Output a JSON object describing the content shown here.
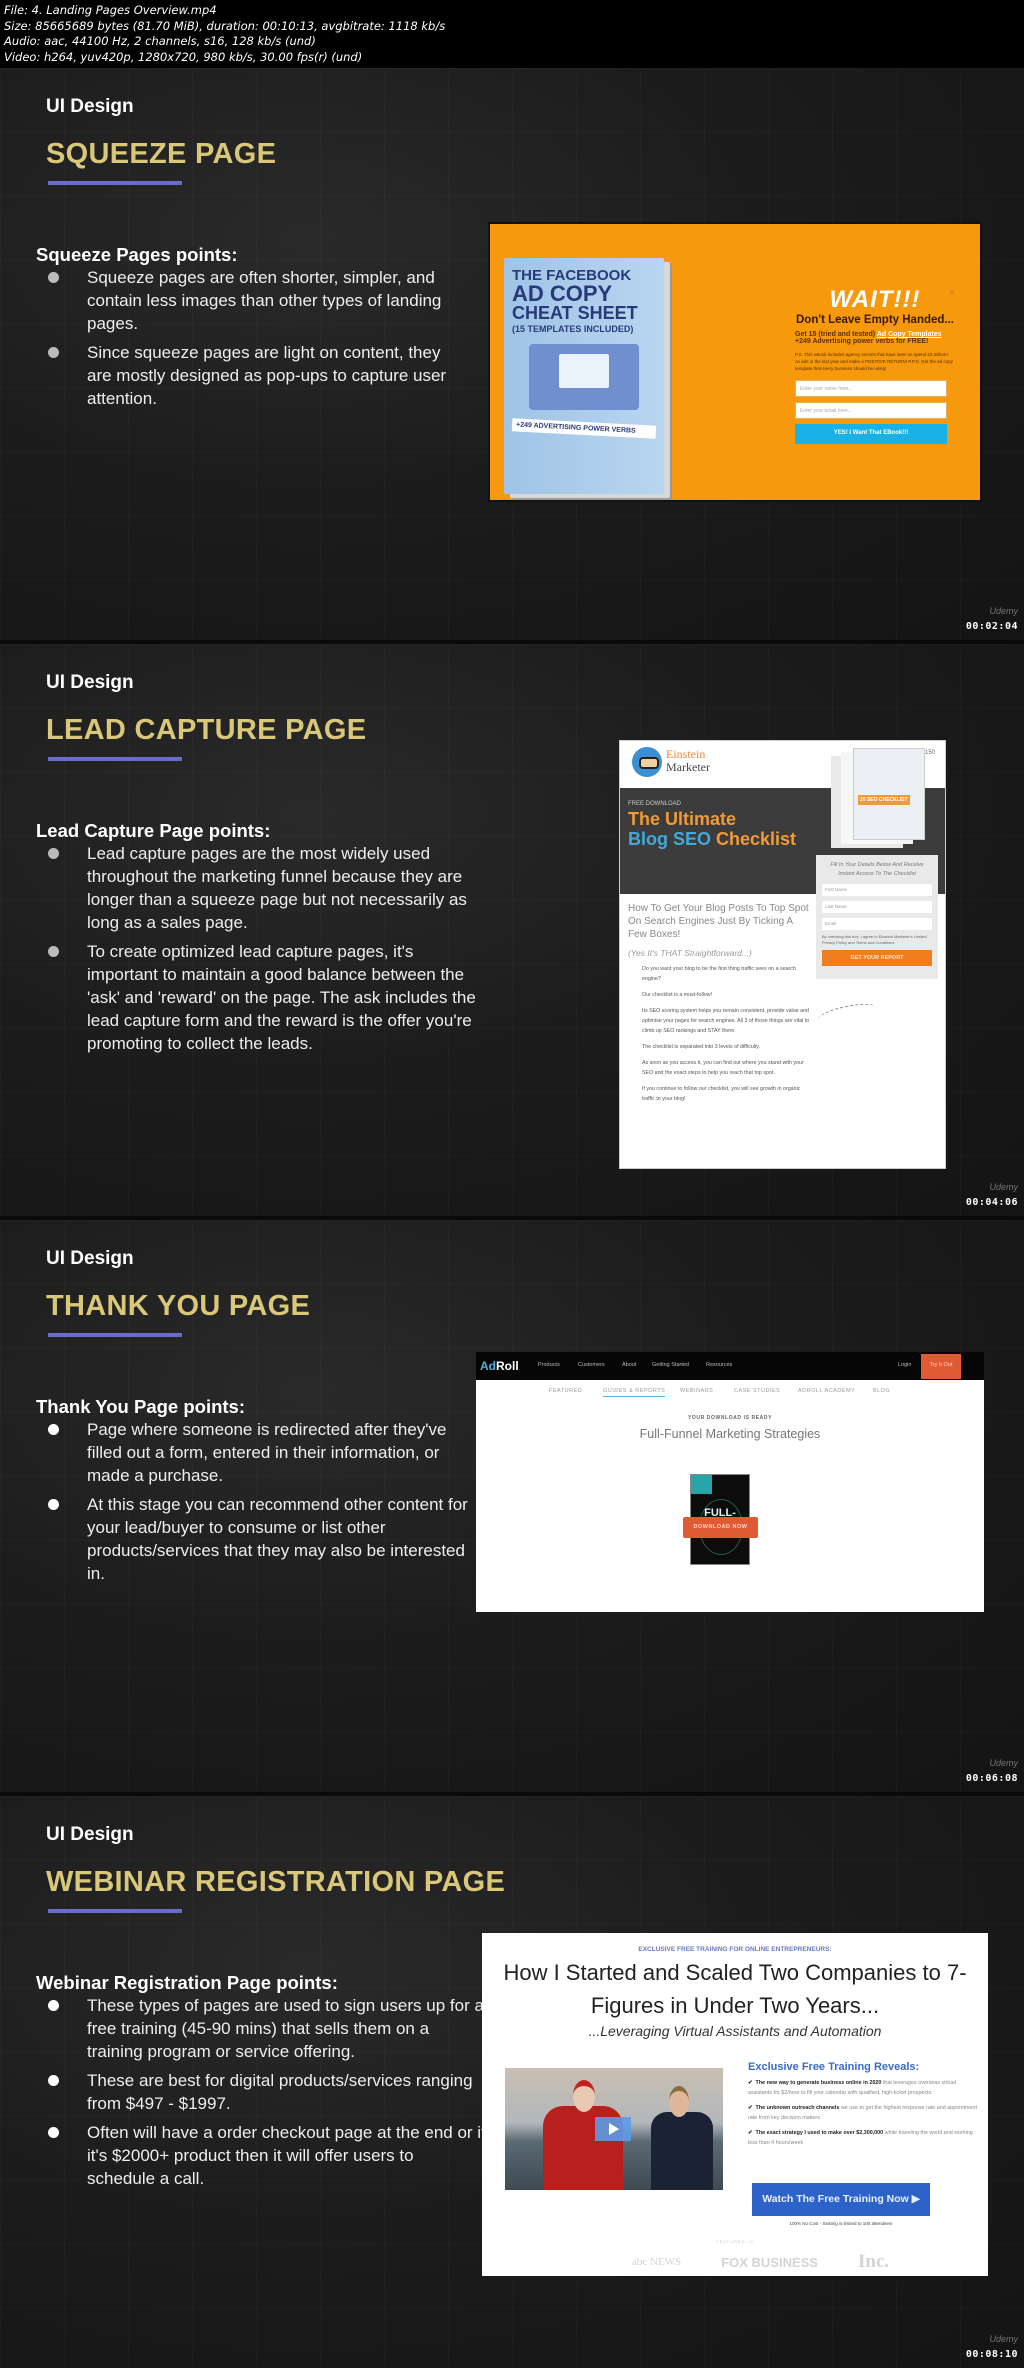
{
  "file_info": {
    "file": "File: 4. Landing Pages Overview.mp4",
    "size": "Size: 85665689 bytes (81.70 MiB), duration: 00:10:13, avgbitrate: 1118 kb/s",
    "audio": "Audio: aac, 44100 Hz, 2 channels, s16, 128 kb/s (und)",
    "video": "Video: h264, yuv420p, 1280x720, 980 kb/s, 30.00 fps(r) (und)"
  },
  "watermark_brand": "Udemy",
  "slides": [
    {
      "kicker": "UI Design",
      "title": "SQUEEZE PAGE",
      "points_heading": "Squeeze Pages points:",
      "points": [
        "Squeeze pages are often shorter, simpler, and contain less images than other types of landing pages.",
        "Since squeeze pages are light on content, they are mostly designed as pop-ups to capture user attention."
      ],
      "timestamp": "00:02:04",
      "screenshot": {
        "book_line1": "THE FACEBOOK",
        "book_line2": "AD COPY",
        "book_line3": "CHEAT SHEET",
        "book_line4": "(15 TEMPLATES INCLUDED)",
        "book_ribbon": "+249 ADVERTISING POWER VERBS",
        "popup_wait": "WAIT!!!",
        "popup_close": "×",
        "popup_headline": "Don't Leave Empty Handed...",
        "popup_get_prefix": "Get 15 (tried and tested) ",
        "popup_get_link": "Ad Copy Templates",
        "popup_get_suffix": " +249 Advertising power verbs for FREE!",
        "popup_ps": "P.S. This eBook includes agency secrets that have seen us spend £3 million+ on ads in the last year and make a POSITIVE RETURN! P.P.S. Get the ad copy template that every business should be using!",
        "name_placeholder": "Enter your name here...",
        "email_placeholder": "Enter your email here...",
        "cta": "YES! I Want That EBook!!!"
      }
    },
    {
      "kicker": "UI Design",
      "title": "LEAD CAPTURE PAGE",
      "points_heading": "Lead Capture Page points:",
      "points": [
        "Lead capture pages are the most widely used throughout the marketing funnel because they are longer than a squeeze page but not necessarily as long as a sales page.",
        "To create optimized lead capture pages, it's important to maintain a good balance between the 'ask' and 'reward' on the page. The ask includes the lead capture form and the reward is the offer you're promoting to collect the leads."
      ],
      "timestamp": "00:04:06",
      "screenshot": {
        "brand_line1": "Einstein",
        "brand_line2": "Marketer",
        "phone": "☎ +44 (0) 203 500 1150",
        "free_download": "FREE DOWNLOAD",
        "headline_line1": "The Ultimate",
        "headline_blue": "Blog SEO",
        "headline_orange": " Checklist",
        "cover_tag": "20 SEO CHECKLIST",
        "form_heading": "Fill In Your Details Below And Receive Instant Access To The Checklist",
        "first_name": "First Name",
        "last_name": "Last Name",
        "email": "Email",
        "agree": "By checking this box, I agree to Einstein Marketer's Limited Privacy Policy and Terms and Conditions",
        "form_button": "GET YOUR REPORT",
        "subheadline": "How To Get Your Blog Posts To Top Spot On Search Engines Just By Ticking A Few Boxes!",
        "yes_line": "(Yes It's THAT Straightforward...)",
        "paragraphs": [
          "Do you want your blog to be the first thing traffic sees on a search engine?",
          "Our checklist is a must-follow!",
          "Its SEO scoring system helps you remain consistent, provide value and optimise your pages for search engines. All 3 of those things are vital to climb up SEO rankings and STAY there.",
          "The checklist is separated into 3 levels of difficulty.",
          "As soon as you access it, you can find out where you stand with your SEO and the exact steps to help you reach that top spot.",
          "If you continue to follow our checklist, you will see growth in organic traffic to your blog!"
        ]
      }
    },
    {
      "kicker": "UI Design",
      "title": "THANK YOU PAGE",
      "points_heading": "Thank You Page points:",
      "points": [
        "Page where someone is redirected after they've filled out a form, entered in their information, or made a purchase.",
        "At this stage you can recommend other content for your lead/buyer to consume or list other products/services that they may also be interested in."
      ],
      "timestamp": "00:06:08",
      "screenshot": {
        "logo_a": "Ad",
        "logo_b": "Roll",
        "nav": [
          "Products",
          "Customers",
          "About",
          "Getting Started",
          "Resources"
        ],
        "login": "Login",
        "try": "Try It Out",
        "subnav": [
          "FEATURED",
          "GUIDES & REPORTS",
          "WEBINARS",
          "CASE STUDIES",
          "ADROLL ACADEMY",
          "BLOG"
        ],
        "ready": "YOUR DOWNLOAD IS READY",
        "heading": "Full-Funnel Marketing Strategies",
        "cover_title": "FULL-FUNNEL",
        "download": "DOWNLOAD NOW"
      }
    },
    {
      "kicker": "UI Design",
      "title": "WEBINAR REGISTRATION PAGE",
      "points_heading": "Webinar Registration Page points:",
      "points": [
        "These types of pages are used to sign users up for a free training (45-90 mins) that sells them on a training program or service offering.",
        "These are best for digital products/services ranging from $497 - $1997.",
        "Often will have a order checkout page at the end or if it's $2000+ product then it will offer users to schedule a call."
      ],
      "timestamp": "00:08:10",
      "screenshot": {
        "eyebrow": "EXCLUSIVE FREE TRAINING FOR ONLINE ENTREPRENEURS:",
        "title": "How I Started and Scaled Two Companies to 7-Figures in Under Two Years...",
        "subtitle": "...Leveraging Virtual Assistants and Automation",
        "reveals_heading": "Exclusive Free Training Reveals:",
        "reveals": [
          {
            "bold": "The new way to generate business online in 2020",
            "rest": " that leverages overseas virtual assistants for $2/hour to fill your calendar with qualified, high-ticket prospects"
          },
          {
            "bold": "The unknown outreach channels",
            "rest": " we use to get the highest response rate and appointment rate from key decision makers"
          },
          {
            "bold": "The exact strategy I used to make over $2,300,000",
            "rest": " while traveling the world and working less than 4 hours/week"
          }
        ],
        "watch": "Watch The Free Training Now ▶",
        "no_cost": "100% No Cost - Seating is limited to 100 attendees!",
        "featured": "FEATURED IN",
        "logos": [
          "abc NEWS",
          "FOX BUSINESS",
          "Inc."
        ]
      }
    }
  ]
}
